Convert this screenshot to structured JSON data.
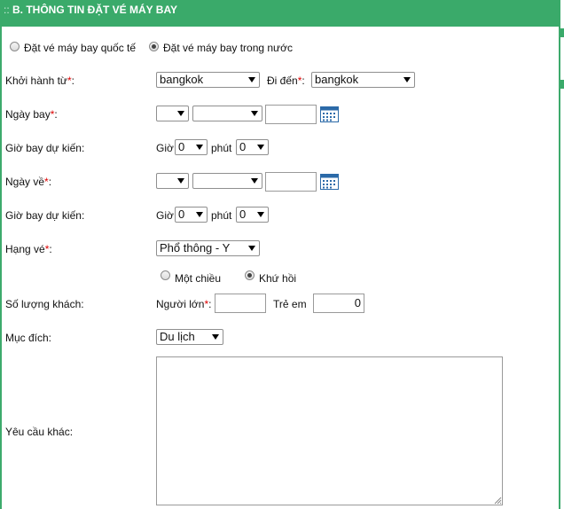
{
  "header": {
    "prefix": "::",
    "title": "B. THÔNG TIN ĐẶT VÉ MÁY BAY"
  },
  "trip_type": {
    "international": "Đặt vé máy bay quốc tế",
    "domestic": "Đặt vé máy bay trong nước",
    "selected": "domestic"
  },
  "departure": {
    "label": "Khởi hành từ",
    "required": "*",
    "value": "bangkok"
  },
  "destination": {
    "label": "Đi đến",
    "required": "*",
    "value": "bangkok"
  },
  "depart_date": {
    "label": "Ngày bay",
    "required": "*",
    "day": "",
    "month": "",
    "year": ""
  },
  "depart_time": {
    "label": "Giờ bay dự kiến:",
    "hour_label": "Giờ",
    "hour": "0",
    "minute_label": "phút",
    "minute": "0"
  },
  "return_date": {
    "label": "Ngày về",
    "required": "*",
    "day": "",
    "month": "",
    "year": ""
  },
  "return_time": {
    "label": "Giờ bay dự kiến:",
    "hour_label": "Giờ",
    "hour": "0",
    "minute_label": "phút",
    "minute": "0"
  },
  "ticket_class": {
    "label": "Hạng vé",
    "required": "*",
    "value": "Phổ thông - Y"
  },
  "way": {
    "one_way": "Một chiều",
    "round_trip": "Khứ hồi",
    "selected": "round_trip"
  },
  "passengers": {
    "label": "Số lượng khách:",
    "adult_label": "Người lớn",
    "required": "*",
    "adult": "",
    "child_label": "Trẻ em",
    "child": "0"
  },
  "purpose": {
    "label": "Mục đích:",
    "value": "Du lịch"
  },
  "other_request": {
    "label": "Yêu cầu khác:",
    "value": ""
  },
  "colors": {
    "header_bg": "#3aaa6a",
    "required": "#dd0000"
  },
  "colon": ":"
}
